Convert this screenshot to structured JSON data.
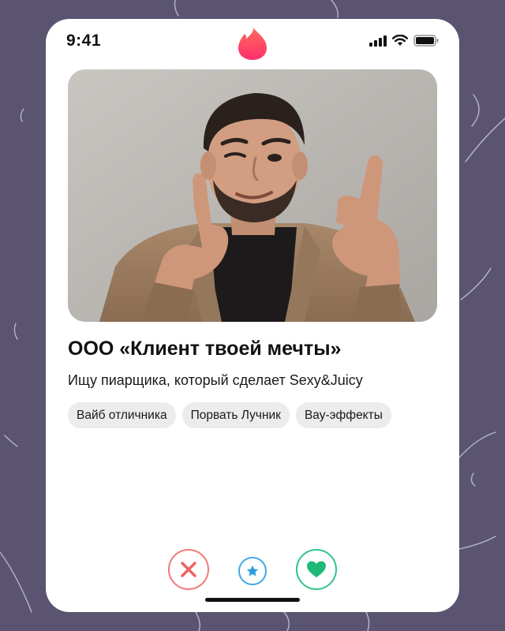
{
  "status_bar": {
    "time": "9:41"
  },
  "app": {
    "logo_icon": "flame-icon",
    "accent_color": "#fe4c63"
  },
  "profile": {
    "photo_alt": "Мужчина в бежевом пиджаке показывает на зрителя",
    "name": "ООО «Клиент твоей мечты»",
    "description": "Ищу пиарщика, который сделает Sexy&Juicy",
    "tags": [
      {
        "label": "Вайб отличника"
      },
      {
        "label": "Порвать Лучник"
      },
      {
        "label": "Вау-эффекты"
      }
    ]
  },
  "actions": {
    "nope_icon": "close-icon",
    "super_like_icon": "star-icon",
    "like_icon": "heart-icon",
    "nope_color": "#f07a7a",
    "super_like_color": "#3fa8e8",
    "like_color": "#31c48a"
  }
}
